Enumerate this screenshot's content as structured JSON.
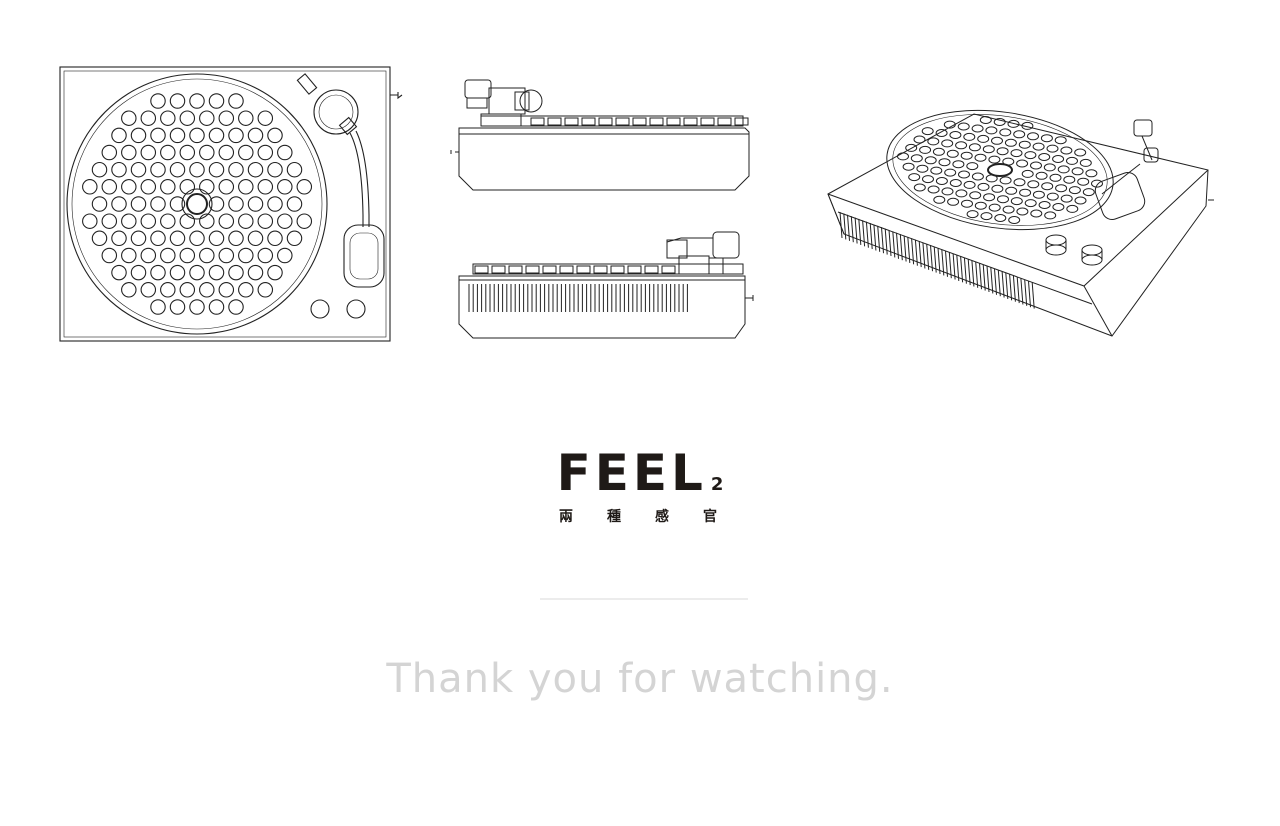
{
  "brand": {
    "word": "FEEL",
    "subscript": "2",
    "chinese": "兩種感官"
  },
  "closing": {
    "text": "Thank you for watching."
  },
  "colors": {
    "background": "#ffffff",
    "line_art": "#1f1a17",
    "closing_text": "#d4d4d4",
    "divider": "#ececec"
  },
  "drawings": [
    "turntable-top-view",
    "turntable-side-views",
    "turntable-isometric-view"
  ]
}
